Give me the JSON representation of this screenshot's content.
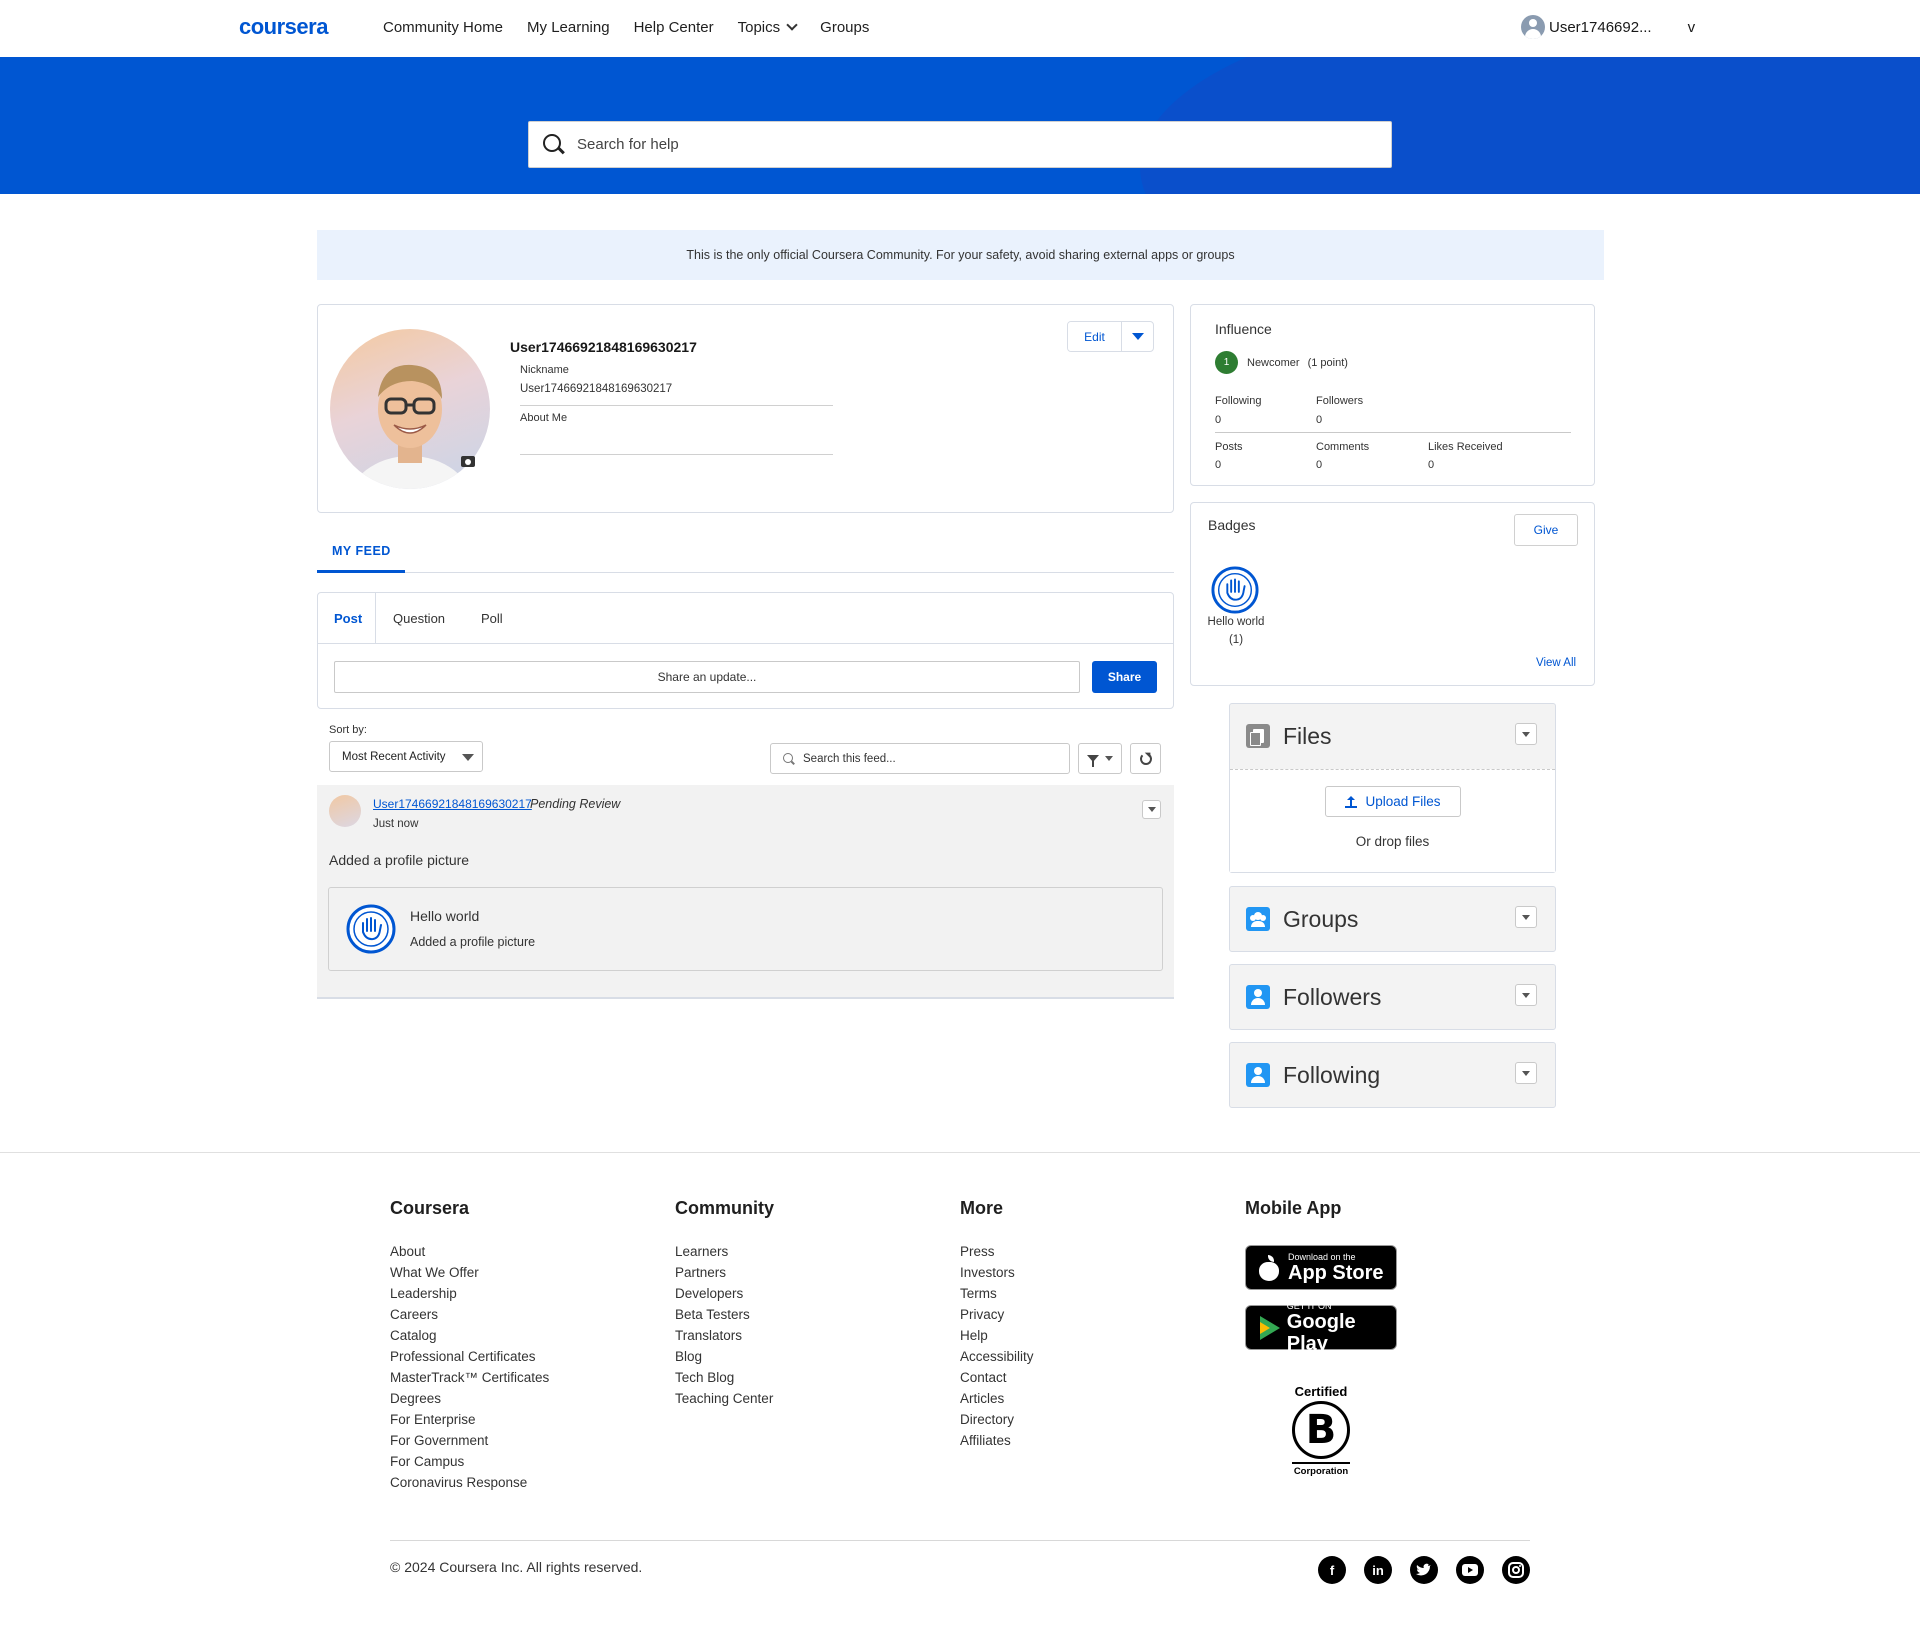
{
  "nav": {
    "logo": "coursera",
    "links": [
      "Community Home",
      "My Learning",
      "Help Center",
      "Topics",
      "Groups"
    ],
    "user": "User1746692...",
    "user_caret": "v"
  },
  "search": {
    "placeholder": "Search for help"
  },
  "notice": "This is the only official Coursera Community. For your safety, avoid sharing external apps or groups",
  "profile": {
    "name": "User1746692184816963021​7",
    "nickname_label": "Nickname",
    "nickname_value": "User17466921848169630217",
    "about_label": "About Me",
    "edit_label": "Edit"
  },
  "feed_tab": "MY FEED",
  "publisher": {
    "tabs": [
      "Post",
      "Question",
      "Poll"
    ],
    "input_placeholder": "Share an update...",
    "share_label": "Share"
  },
  "sort": {
    "label": "Sort by:",
    "value": "Most Recent Activity",
    "search_placeholder": "Search this feed..."
  },
  "feed_item": {
    "author": "User17466921848169630217",
    "status": "Pending Review",
    "time": "Just now",
    "text": "Added a profile picture",
    "attachment_title": "Hello world",
    "attachment_sub": "Added a profile picture"
  },
  "influence": {
    "title": "Influence",
    "level_number": "1",
    "level_name": "Newcomer",
    "points": "(1 point)",
    "stats": [
      {
        "label": "Following",
        "value": "0"
      },
      {
        "label": "Followers",
        "value": "0"
      },
      {
        "label": "Posts",
        "value": "0"
      },
      {
        "label": "Comments",
        "value": "0"
      },
      {
        "label": "Likes Received",
        "value": "0"
      }
    ]
  },
  "badges": {
    "title": "Badges",
    "give_label": "Give",
    "badge_name": "Hello world",
    "badge_count": "(1)",
    "view_all": "View All"
  },
  "panels": {
    "files": "Files",
    "upload": "Upload Files",
    "drop": "Or drop files",
    "groups": "Groups",
    "followers": "Followers",
    "following": "Following"
  },
  "footer": {
    "columns": [
      {
        "title": "Coursera",
        "links": [
          "About",
          "What We Offer",
          "Leadership",
          "Careers",
          "Catalog",
          "Professional Certificates",
          "MasterTrack™ Certificates",
          "Degrees",
          "For Enterprise",
          "For Government",
          "For Campus",
          "Coronavirus Response"
        ]
      },
      {
        "title": "Community",
        "links": [
          "Learners",
          "Partners",
          "Developers",
          "Beta Testers",
          "Translators",
          "Blog",
          "Tech Blog",
          "Teaching Center"
        ]
      },
      {
        "title": "More",
        "links": [
          "Press",
          "Investors",
          "Terms",
          "Privacy",
          "Help",
          "Accessibility",
          "Contact",
          "Articles",
          "Directory",
          "Affiliates"
        ]
      }
    ],
    "mobile_title": "Mobile App",
    "appstore_small": "Download on the",
    "appstore_big": "App Store",
    "play_small": "GET IT ON",
    "play_big": "Google Play",
    "bcorp_top": "Certified",
    "bcorp_letter": "B",
    "bcorp_bottom": "Corporation",
    "copyright": "© 2024 Coursera Inc. All rights reserved.",
    "social_icons": [
      "facebook-icon",
      "linkedin-icon",
      "twitter-icon",
      "youtube-icon",
      "instagram-icon"
    ]
  }
}
